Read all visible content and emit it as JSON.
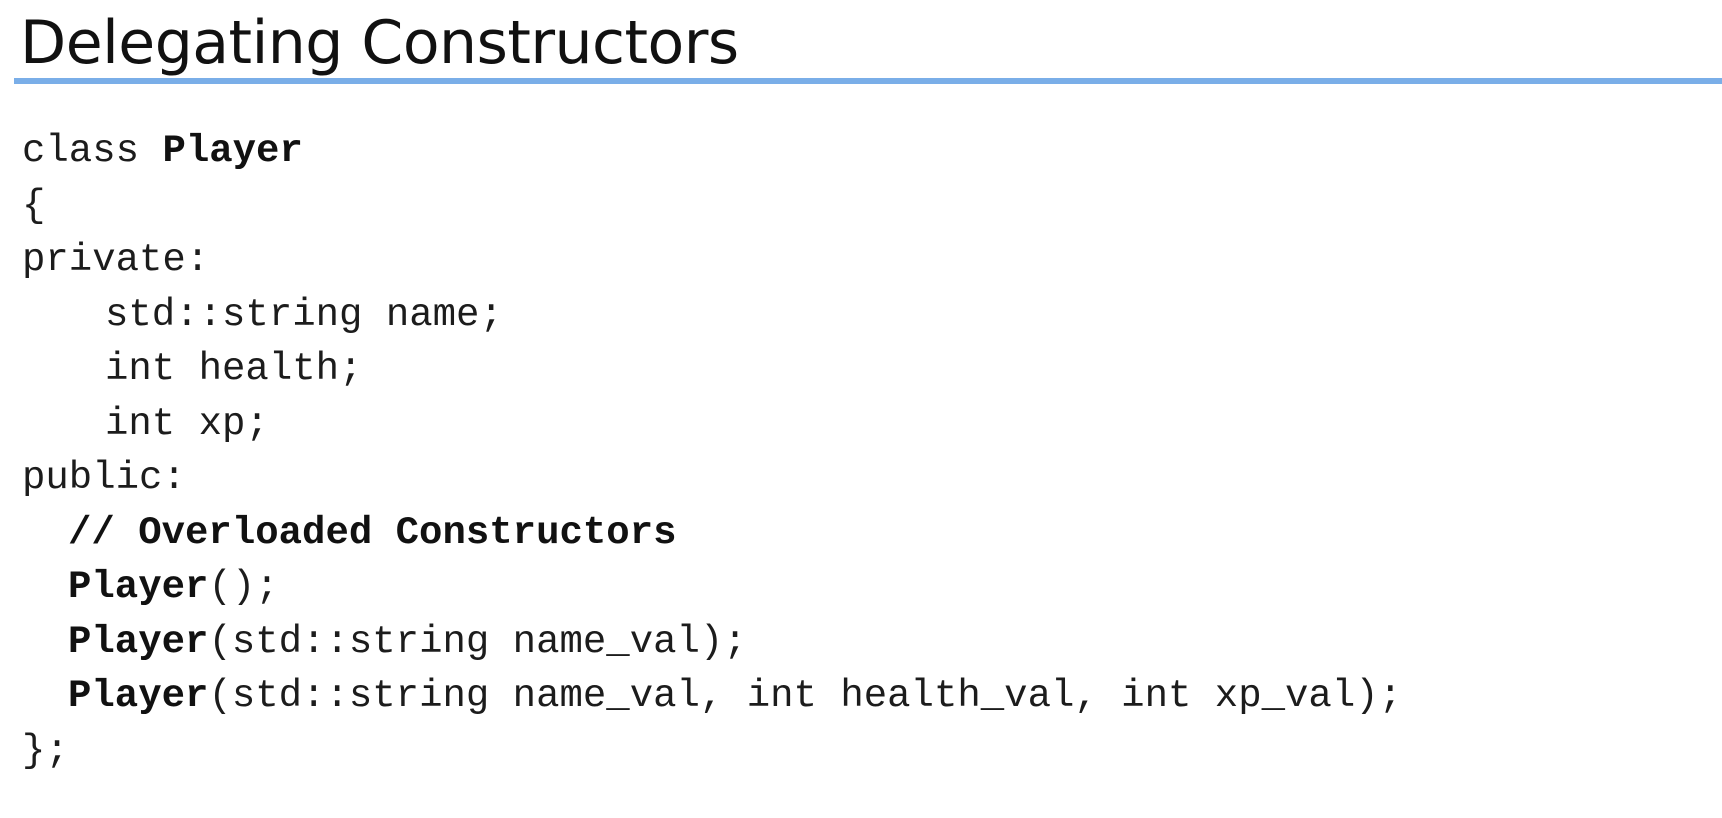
{
  "slide": {
    "title": "Delegating Constructors"
  },
  "code": {
    "class_keyword": "class ",
    "class_name": "Player",
    "open_brace": "{",
    "private_label": "private:",
    "member_name": "std::string name;",
    "member_health": "int health;",
    "member_xp": "int xp;",
    "public_label": "public:",
    "comment": "// Overloaded Constructors",
    "ctor1_name": "Player",
    "ctor1_params": "();",
    "ctor2_name": "Player",
    "ctor2_params": "(std::string name_val);",
    "ctor3_name": "Player",
    "ctor3_params": "(std::string name_val, int health_val, int xp_val);",
    "close_brace": "};"
  },
  "colors": {
    "title_rule": "#7aaee8",
    "text": "#1c1c1c",
    "background": "#ffffff"
  }
}
